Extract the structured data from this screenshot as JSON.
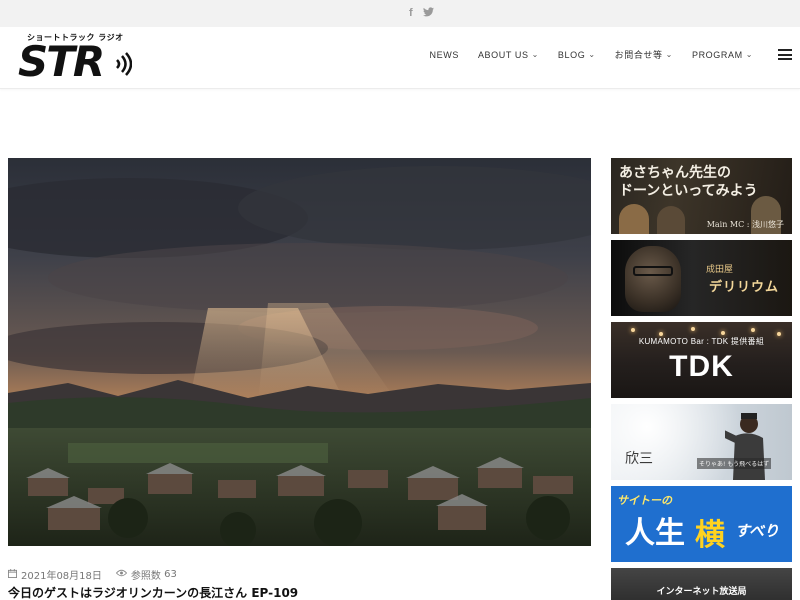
{
  "topbar": {
    "social": [
      {
        "icon": "facebook-icon",
        "glyph": "f"
      },
      {
        "icon": "twitter-icon",
        "glyph": "🐦"
      }
    ]
  },
  "header": {
    "logo": {
      "kana": "ショートトラック ラジオ",
      "mark": "STR"
    },
    "nav": [
      {
        "label": "NEWS",
        "dropdown": false
      },
      {
        "label": "ABOUT US",
        "dropdown": true
      },
      {
        "label": "BLOG",
        "dropdown": true
      },
      {
        "label": "お問合せ等",
        "dropdown": true
      },
      {
        "label": "PROGRAM",
        "dropdown": true
      }
    ],
    "chevron": "⌄",
    "menu_icon": "hamburger-menu-icon"
  },
  "post": {
    "date": "2021年08月18日",
    "views_label": "参照数",
    "views": "63",
    "title": "今日のゲストはラジオリンカーンの長江さん EP-109"
  },
  "sidebar": {
    "banner1": {
      "title_line1": "あさちゃん先生の",
      "title_line2": "ドーンといってみよう",
      "mc": "Main MC : 浅川悠子"
    },
    "banner2": {
      "small": "成田屋",
      "title": "デリリウム"
    },
    "banner3": {
      "subtitle": "KUMAMOTO Bar : TDK 提供番組",
      "title": "TDK"
    },
    "banner4": {
      "name": "欣三",
      "caption": "そりゃあ!  もう飛べるはず"
    },
    "banner5": {
      "small": "サイトーの",
      "word1": "人生",
      "word2": "横",
      "word3": "すべり"
    },
    "banner6": {
      "title": "インターネット放送局"
    }
  }
}
